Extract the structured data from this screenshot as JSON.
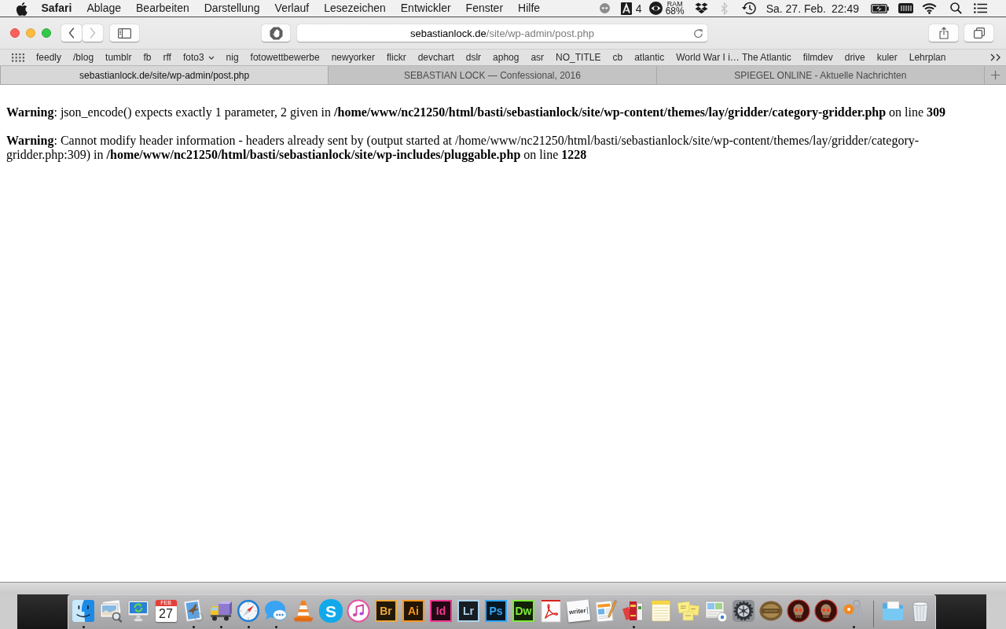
{
  "menu_bar": {
    "menus": [
      {
        "kind": "app",
        "label": "Safari"
      },
      {
        "kind": "menu",
        "label": "Ablage"
      },
      {
        "kind": "menu",
        "label": "Bearbeiten"
      },
      {
        "kind": "menu",
        "label": "Darstellung"
      },
      {
        "kind": "menu",
        "label": "Verlauf"
      },
      {
        "kind": "menu",
        "label": "Lesezeichen"
      },
      {
        "kind": "menu",
        "label": "Entwickler"
      },
      {
        "kind": "menu",
        "label": "Fenster"
      },
      {
        "kind": "menu",
        "label": "Hilfe"
      }
    ],
    "status_items": [
      {
        "kind": "dot",
        "disabled": false
      },
      {
        "kind": "adobe",
        "label": "4",
        "disabled": false
      },
      {
        "kind": "ram",
        "caption": "RAM",
        "label": "68%",
        "disabled": false
      },
      {
        "kind": "dropbox",
        "disabled": false
      },
      {
        "kind": "bluetooth",
        "disabled": true
      },
      {
        "kind": "time_machine",
        "disabled": false
      },
      {
        "kind": "clock",
        "date": "Sa. 27. Feb.",
        "time": "22:49",
        "disabled": false
      },
      {
        "kind": "battery",
        "disabled": false
      },
      {
        "kind": "memory",
        "disabled": false
      },
      {
        "kind": "wifi",
        "disabled": false
      },
      {
        "kind": "search",
        "disabled": false
      },
      {
        "kind": "notifications",
        "disabled": false
      }
    ]
  },
  "toolbar": {
    "back": {
      "disabled": false
    },
    "forward": {
      "disabled": true
    },
    "address": {
      "host": "sebastianlock.de",
      "path": "/site/wp-admin/post.php"
    }
  },
  "bookmarks": [
    {
      "kind": "link",
      "label": "feedly"
    },
    {
      "kind": "link",
      "label": "/blog"
    },
    {
      "kind": "link",
      "label": "tumblr"
    },
    {
      "kind": "link",
      "label": "fb"
    },
    {
      "kind": "link",
      "label": "rff"
    },
    {
      "kind": "folder",
      "label": "foto3"
    },
    {
      "kind": "link",
      "label": "nig"
    },
    {
      "kind": "link",
      "label": "fotowettbewerbe"
    },
    {
      "kind": "link",
      "label": "newyorker"
    },
    {
      "kind": "link",
      "label": "flickr"
    },
    {
      "kind": "link",
      "label": "devchart"
    },
    {
      "kind": "link",
      "label": "dslr"
    },
    {
      "kind": "link",
      "label": "aphog"
    },
    {
      "kind": "link",
      "label": "asr"
    },
    {
      "kind": "link",
      "label": "NO_TITLE"
    },
    {
      "kind": "link",
      "label": "cb"
    },
    {
      "kind": "link",
      "label": "atlantic"
    },
    {
      "kind": "link",
      "label": "World War I i… The Atlantic"
    },
    {
      "kind": "link",
      "label": "filmdev"
    },
    {
      "kind": "link",
      "label": "drive"
    },
    {
      "kind": "link",
      "label": "kuler"
    },
    {
      "kind": "link",
      "label": "Lehrplan"
    }
  ],
  "tabs": [
    {
      "title": "sebastianlock.de/site/wp-admin/post.php",
      "selected": true
    },
    {
      "title": "SEBASTIAN LOCK — Confessional, 2016",
      "selected": false
    },
    {
      "title": "SPIEGEL ONLINE - Aktuelle Nachrichten",
      "selected": false
    }
  ],
  "page": {
    "messages": [
      "**Warning**: json_encode() expects exactly 1 parameter, 2 given in **/home/www/nc21250/html/basti/sebastianlock/site/wp-content/themes/lay/gridder/category-gridder.php** on line **309**",
      "**Warning**: Cannot modify header information - headers already sent by (output started at /home/www/nc21250/html/basti/sebastianlock/site/wp-content/themes/lay/gridder/category-gridder.php:309) in **/home/www/nc21250/html/basti/sebastianlock/site/wp-includes/pluggable.php** on line **1228**"
    ]
  },
  "dock": {
    "apps": [
      {
        "kind": "finder",
        "running": true
      },
      {
        "kind": "preview",
        "running": false
      },
      {
        "kind": "monitor",
        "running": false
      },
      {
        "kind": "calendar",
        "month": "FEB",
        "day": "27",
        "running": false
      },
      {
        "kind": "stamp",
        "running": true
      },
      {
        "kind": "truck",
        "running": true
      },
      {
        "kind": "compass",
        "running": true
      },
      {
        "kind": "bubble",
        "running": true
      },
      {
        "kind": "cone",
        "running": false
      },
      {
        "kind": "round_tile",
        "label": "S",
        "color": "#12a9ea",
        "running": false
      },
      {
        "kind": "music",
        "running": false
      },
      {
        "kind": "tile",
        "label": "Br",
        "color": "#eea83c",
        "running": false
      },
      {
        "kind": "tile",
        "label": "Ai",
        "color": "#f9961e",
        "running": false
      },
      {
        "kind": "tile",
        "label": "Id",
        "color": "#f0388f",
        "running": false
      },
      {
        "kind": "tile",
        "label": "Lr",
        "color": "#acd2ec",
        "running": false
      },
      {
        "kind": "tile",
        "label": "Ps",
        "color": "#31a6f6",
        "running": false
      },
      {
        "kind": "tile",
        "label": "Dw",
        "color": "#7fea3a",
        "running": false
      },
      {
        "kind": "acrobat",
        "running": false
      },
      {
        "kind": "writer",
        "label": "writer",
        "running": false
      },
      {
        "kind": "document_pencil",
        "running": false
      },
      {
        "kind": "books",
        "running": true
      },
      {
        "kind": "notepad",
        "running": false
      },
      {
        "kind": "stickies",
        "running": false
      },
      {
        "kind": "map",
        "running": false
      },
      {
        "kind": "gear",
        "running": false
      },
      {
        "kind": "medallion",
        "running": false
      },
      {
        "kind": "skull",
        "running": false
      },
      {
        "kind": "skull",
        "running": false
      },
      {
        "kind": "keys",
        "running": true
      }
    ],
    "stacks": [
      {
        "kind": "folder"
      },
      {
        "kind": "trash"
      }
    ]
  }
}
